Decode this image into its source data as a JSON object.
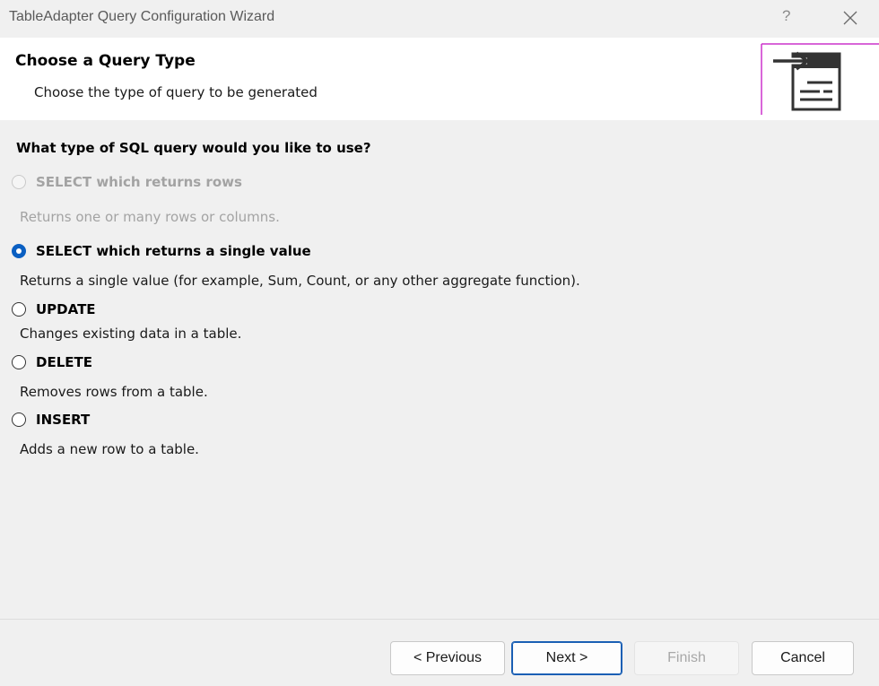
{
  "window": {
    "title": "TableAdapter Query Configuration Wizard",
    "help": "?"
  },
  "header": {
    "title": "Choose a Query Type",
    "subtitle": "Choose the type of query to be generated"
  },
  "content": {
    "question": "What type of SQL query would you like to use?",
    "options": [
      {
        "label": "SELECT which returns rows",
        "description": "Returns one or many rows or columns.",
        "selected": false,
        "enabled": false
      },
      {
        "label": "SELECT which returns a single value",
        "description": "Returns a single value (for example, Sum, Count, or any other aggregate function).",
        "selected": true,
        "enabled": true
      },
      {
        "label": "UPDATE",
        "description": "Changes existing data in a table.",
        "selected": false,
        "enabled": true
      },
      {
        "label": "DELETE",
        "description": "Removes rows from a table.",
        "selected": false,
        "enabled": true
      },
      {
        "label": "INSERT",
        "description": "Adds a new row to a table.",
        "selected": false,
        "enabled": true
      }
    ]
  },
  "footer": {
    "previous_label": "< Previous",
    "next_label": "Next >",
    "finish_label": "Finish",
    "cancel_label": "Cancel"
  },
  "colors": {
    "accent": "#0a5fc2",
    "header_bg": "#ffffff",
    "window_bg": "#f0f0f0",
    "icon_frame": "#cc33cc",
    "disabled_text": "#a3a3a3"
  }
}
